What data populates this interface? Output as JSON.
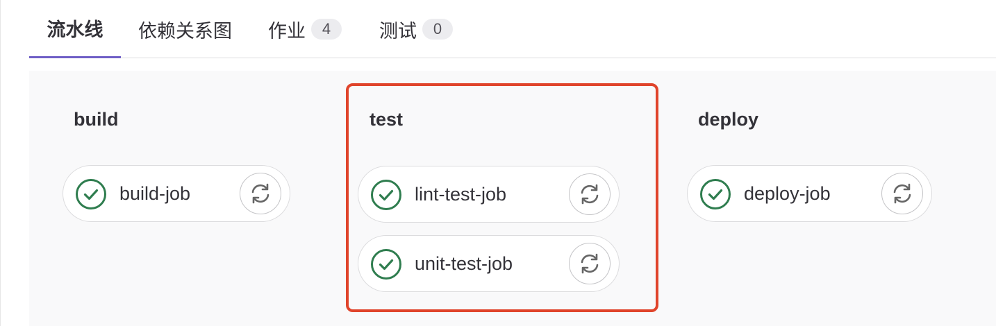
{
  "tabs": [
    {
      "label": "流水线",
      "active": true
    },
    {
      "label": "依赖关系图"
    },
    {
      "label": "作业",
      "count": "4"
    },
    {
      "label": "测试",
      "count": "0"
    }
  ],
  "stages": [
    {
      "title": "build",
      "jobs": [
        {
          "name": "build-job",
          "status": "success"
        }
      ]
    },
    {
      "title": "test",
      "jobs": [
        {
          "name": "lint-test-job",
          "status": "success"
        },
        {
          "name": "unit-test-job",
          "status": "success"
        }
      ]
    },
    {
      "title": "deploy",
      "jobs": [
        {
          "name": "deploy-job",
          "status": "success"
        }
      ]
    }
  ],
  "icons": {
    "status": "check-circle-icon",
    "retry": "retry-icon"
  },
  "colors": {
    "success": "#2f7d4f",
    "active_tab_underline": "#6e5ec6",
    "highlight": "#e0442b",
    "badge_bg": "#ececef",
    "area_bg": "#f9f9fa"
  }
}
